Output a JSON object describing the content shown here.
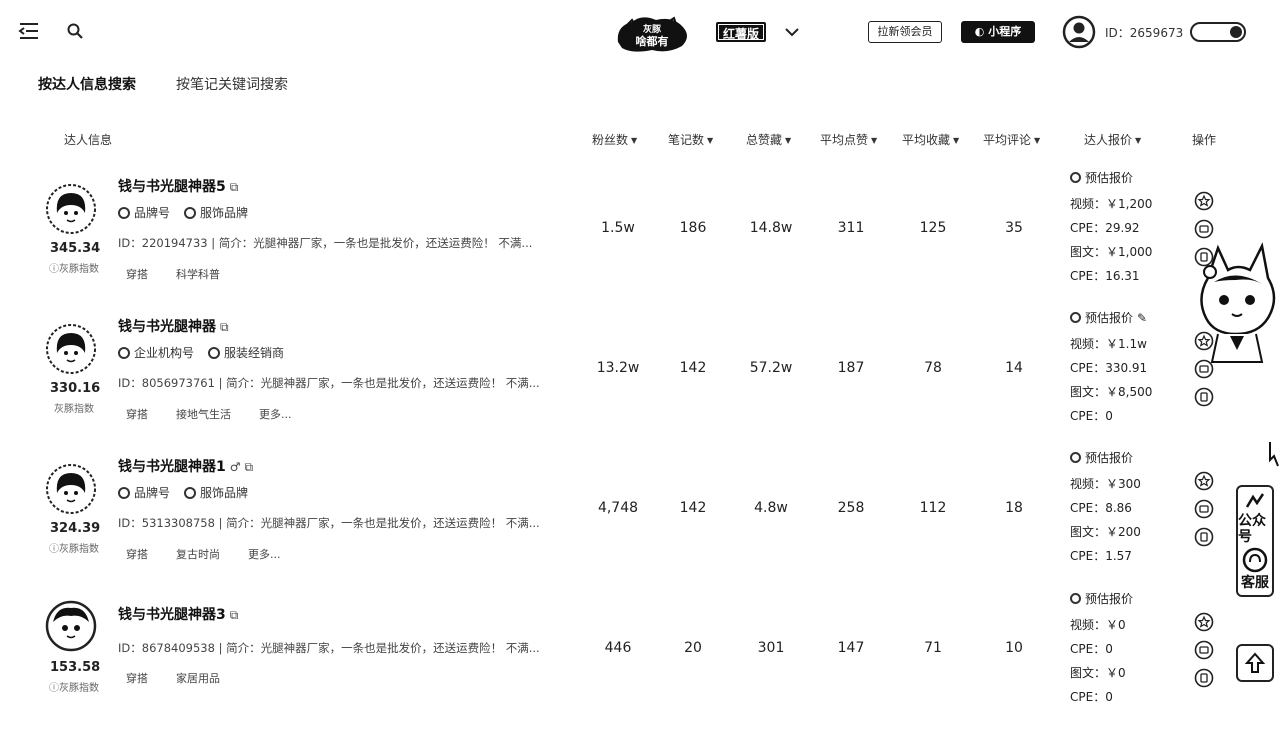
{
  "header": {
    "logo_text": "灰豚 啥都有",
    "edition": "红薯版",
    "invite_label": "拉新领会员",
    "miniapp_label": "小程序",
    "user_id": "ID：2659673"
  },
  "tabs": [
    {
      "label": "按达人信息搜索"
    },
    {
      "label": "按笔记关键词搜索"
    }
  ],
  "columns": {
    "info": "达人信息",
    "fans": "粉丝数",
    "notes": "笔记数",
    "likes": "总赞藏",
    "avg_likes": "平均点赞",
    "avg_collect": "平均收藏",
    "avg_comment": "平均评论",
    "quote": "达人报价",
    "ops": "操作"
  },
  "score_label": "灰豚指数",
  "rows": [
    {
      "name": "钱与书光腿神器5",
      "badge1": "品牌号",
      "badge2": "服饰品牌",
      "desc": "ID：220194733 | 简介：光腿神器厂家，一条也是批发价，还送运费险！ 不满...",
      "tags": [
        "穿搭",
        "科学科普"
      ],
      "score": "345.34",
      "fans": "1.5w",
      "notes": "186",
      "likes": "14.8w",
      "avg_likes": "311",
      "avg_collect": "125",
      "avg_comment": "35",
      "quote_title": "预估报价",
      "q1": "视频：￥1,200",
      "q2": "CPE：29.92",
      "q3": "图文：￥1,000",
      "q4": "CPE：16.31"
    },
    {
      "name": "钱与书光腿神器",
      "badge1": "企业机构号",
      "badge2": "服装经销商",
      "desc": "ID：8056973761 | 简介：光腿神器厂家，一条也是批发价，还送运费险！ 不满...",
      "tags": [
        "穿搭",
        "接地气生活",
        "更多..."
      ],
      "score": "330.16",
      "fans": "13.2w",
      "notes": "142",
      "likes": "57.2w",
      "avg_likes": "187",
      "avg_collect": "78",
      "avg_comment": "14",
      "quote_title": "预估报价",
      "q1": "视频：￥1.1w",
      "q2": "CPE：330.91",
      "q3": "图文：￥8,500",
      "q4": "CPE：0"
    },
    {
      "name": "钱与书光腿神器1",
      "badge1": "品牌号",
      "badge2": "服饰品牌",
      "desc": "ID：5313308758 | 简介：光腿神器厂家，一条也是批发价，还送运费险！ 不满...",
      "tags": [
        "穿搭",
        "复古时尚",
        "更多..."
      ],
      "score": "324.39",
      "fans": "4,748",
      "notes": "142",
      "likes": "4.8w",
      "avg_likes": "258",
      "avg_collect": "112",
      "avg_comment": "18",
      "quote_title": "预估报价",
      "q1": "视频：￥300",
      "q2": "CPE：8.86",
      "q3": "图文：￥200",
      "q4": "CPE：1.57"
    },
    {
      "name": "钱与书光腿神器3",
      "badge1": "",
      "badge2": "",
      "desc": "ID：8678409538 | 简介：光腿神器厂家，一条也是批发价，还送运费险！ 不满...",
      "tags": [
        "穿搭",
        "家居用品"
      ],
      "score": "153.58",
      "fans": "446",
      "notes": "20",
      "likes": "301",
      "avg_likes": "147",
      "avg_collect": "71",
      "avg_comment": "10",
      "quote_title": "预估报价",
      "q1": "视频：￥0",
      "q2": "CPE：0",
      "q3": "图文：￥0",
      "q4": "CPE：0"
    }
  ],
  "float": {
    "wechat_label": "公众号",
    "service_label": "客服"
  }
}
